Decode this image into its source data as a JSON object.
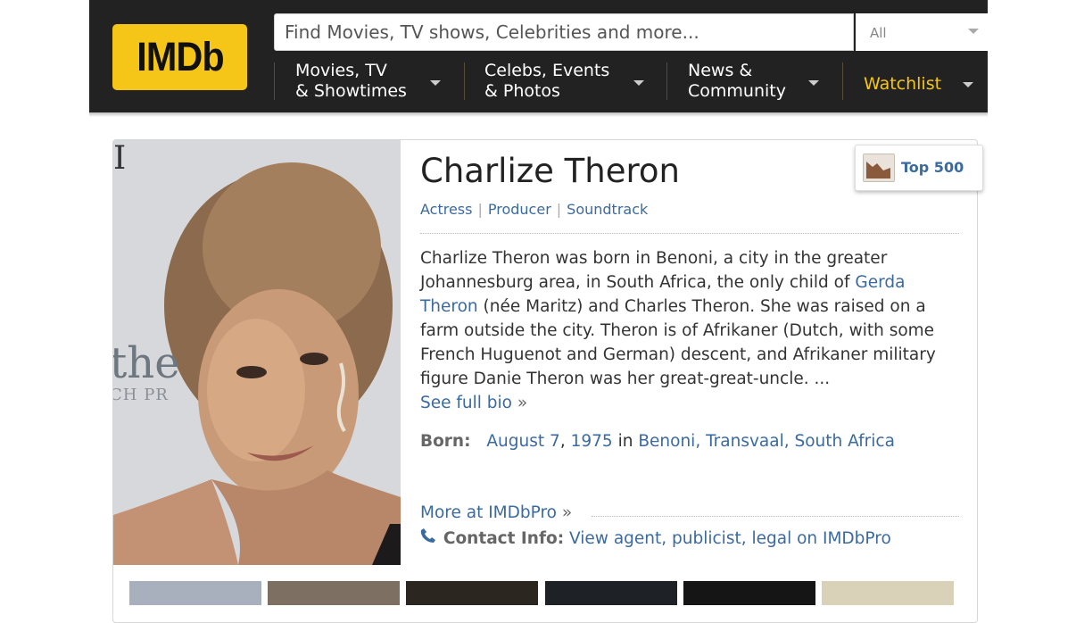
{
  "header": {
    "logo": "IMDb",
    "search_placeholder": "Find Movies, TV shows, Celebrities and more...",
    "search_category": "All",
    "nav": [
      {
        "line1": "Movies, TV",
        "line2": "& Showtimes"
      },
      {
        "line1": "Celebs, Events",
        "line2": "& Photos"
      },
      {
        "line1": "News &",
        "line2": "Community"
      }
    ],
    "watchlist": "Watchlist"
  },
  "person": {
    "name": "Charlize Theron",
    "roles": [
      "Actress",
      "Producer",
      "Soundtrack"
    ],
    "bio": {
      "part1": "Charlize Theron was born in Benoni, a city in the greater Johannesburg area, in South Africa, the only child of ",
      "link": "Gerda Theron",
      "part2": " (née Maritz) and Charles Theron. She was raised on a farm outside the city. Theron is of Afrikaner (Dutch, with some French Huguenot and German) descent, and Afrikaner military figure Danie Theron was her great-great-uncle. ...",
      "see_full": "See full bio",
      "raquo": "»"
    },
    "born": {
      "label": "Born:",
      "date": "August 7",
      "comma": ",",
      "year": "1975",
      "in": "in",
      "place": "Benoni, Transvaal, South Africa"
    },
    "more_pro": "More at IMDbPro",
    "more_raquo": "»",
    "contact": {
      "label": "Contact Info:",
      "link": "View agent, publicist, legal on IMDbPro"
    },
    "photo_text": {
      "large": "the",
      "small": "CH PR",
      "top": "I"
    }
  },
  "badge": {
    "label": "Top 500"
  },
  "colors": {
    "brand": "#f5c518",
    "header_bg": "#222222",
    "link": "#3b6aa0"
  },
  "thumbnails": [
    {
      "color": "#a8b0bd"
    },
    {
      "color": "#7d6f62"
    },
    {
      "color": "#2b2620"
    },
    {
      "color": "#1e2126"
    },
    {
      "color": "#151515"
    },
    {
      "color": "#d9d2b8"
    }
  ]
}
